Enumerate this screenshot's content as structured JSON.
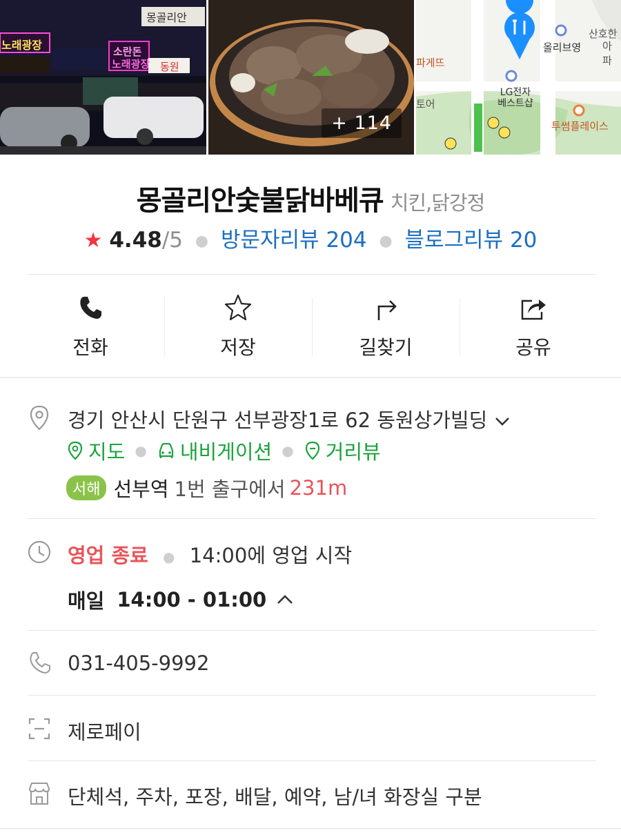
{
  "photos": {
    "count_label": "+ 114",
    "sign_texts": [
      "몽골리안",
      "노래광장",
      "소란돈",
      "노래광장",
      "동원"
    ],
    "map_labels": [
      "올리브영",
      "LG전자 베스트샵",
      "투썸플레이스",
      "산호한",
      "아파",
      "파게뜨",
      "토어"
    ]
  },
  "place": {
    "name": "몽골리안숯불닭바베큐",
    "category": "치킨,닭강정"
  },
  "rating": {
    "star": "★",
    "score": "4.48",
    "max": "/5",
    "visitor_reviews": "방문자리뷰 204",
    "blog_reviews": "블로그리뷰 20"
  },
  "actions": [
    {
      "label": "전화",
      "icon": "phone-icon"
    },
    {
      "label": "저장",
      "icon": "star-outline-icon"
    },
    {
      "label": "길찾기",
      "icon": "directions-arrow-icon"
    },
    {
      "label": "공유",
      "icon": "share-icon"
    }
  ],
  "address": {
    "text": "경기 안산시 단원구 선부광장1로 62 동원상가빌딩"
  },
  "map_links": [
    {
      "label": "지도",
      "icon": "map-pin-icon"
    },
    {
      "label": "내비게이션",
      "icon": "car-icon"
    },
    {
      "label": "거리뷰",
      "icon": "street-view-icon"
    }
  ],
  "subway": {
    "line": "서해",
    "line_color": "#8bc34a",
    "station": "선부역",
    "exit": "1번 출구에서",
    "distance": "231m"
  },
  "hours": {
    "status": "영업 종료",
    "next": "14:00에 영업 시작",
    "day": "매일",
    "time": "14:00 - 01:00"
  },
  "phone": "031-405-9992",
  "payment": "제로페이",
  "amenities": "단체석, 주차, 포장, 배달, 예약, 남/녀 화장실 구분",
  "colors": {
    "star": "#f0373d",
    "link_blue": "#1b6ec2",
    "link_green": "#1aa33b",
    "closed_red": "#e9545a",
    "map_pin": "#1a8fff"
  }
}
